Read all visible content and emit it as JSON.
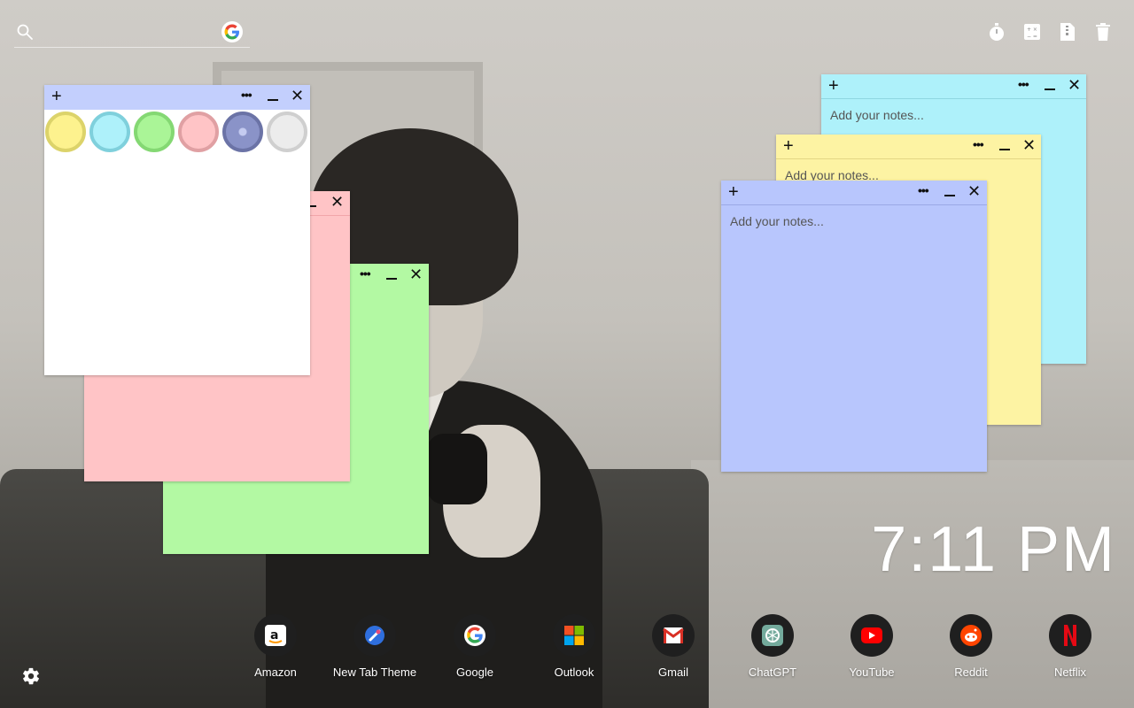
{
  "search": {
    "placeholder": "",
    "engine_icon": "google-icon"
  },
  "top_tools": [
    {
      "name": "timer-icon"
    },
    {
      "name": "calculator-icon"
    },
    {
      "name": "file-zip-icon"
    },
    {
      "name": "trash-icon"
    }
  ],
  "notes": {
    "add_symbol": "+",
    "menu_symbol": "•••",
    "close_symbol": "✕",
    "placeholder": "Add your notes...",
    "colors": {
      "white": "#ffffff",
      "pink": "#ffc4c6",
      "green": "#b3f9a3",
      "cyan": "#aef1fa",
      "yellow": "#fdf3a3",
      "blue": "#b8c6fd",
      "blue_bar": "#c3cffd"
    },
    "palette": [
      {
        "name": "yellow",
        "fill": "#fdf28e",
        "ring": "#dcd36a"
      },
      {
        "name": "cyan",
        "fill": "#aef1fa",
        "ring": "#7fd0dc"
      },
      {
        "name": "green",
        "fill": "#aaf597",
        "ring": "#84d873"
      },
      {
        "name": "pink",
        "fill": "#ffc4c6",
        "ring": "#e0a0a3"
      },
      {
        "name": "blue",
        "fill": "#8a93c8",
        "ring": "#6b73a6"
      },
      {
        "name": "gray",
        "fill": "#ececec",
        "ring": "#cfcfcf"
      }
    ]
  },
  "clock": {
    "time": "7:11 PM"
  },
  "dock": [
    {
      "label": "Amazon",
      "icon": "amazon-icon"
    },
    {
      "label": "New Tab Theme",
      "icon": "new-tab-theme-icon"
    },
    {
      "label": "Google",
      "icon": "google-icon"
    },
    {
      "label": "Outlook",
      "icon": "outlook-icon"
    },
    {
      "label": "Gmail",
      "icon": "gmail-icon"
    },
    {
      "label": "ChatGPT",
      "icon": "chatgpt-icon"
    },
    {
      "label": "YouTube",
      "icon": "youtube-icon"
    },
    {
      "label": "Reddit",
      "icon": "reddit-icon"
    },
    {
      "label": "Netflix",
      "icon": "netflix-icon"
    }
  ],
  "settings": {
    "icon": "gear-icon"
  }
}
